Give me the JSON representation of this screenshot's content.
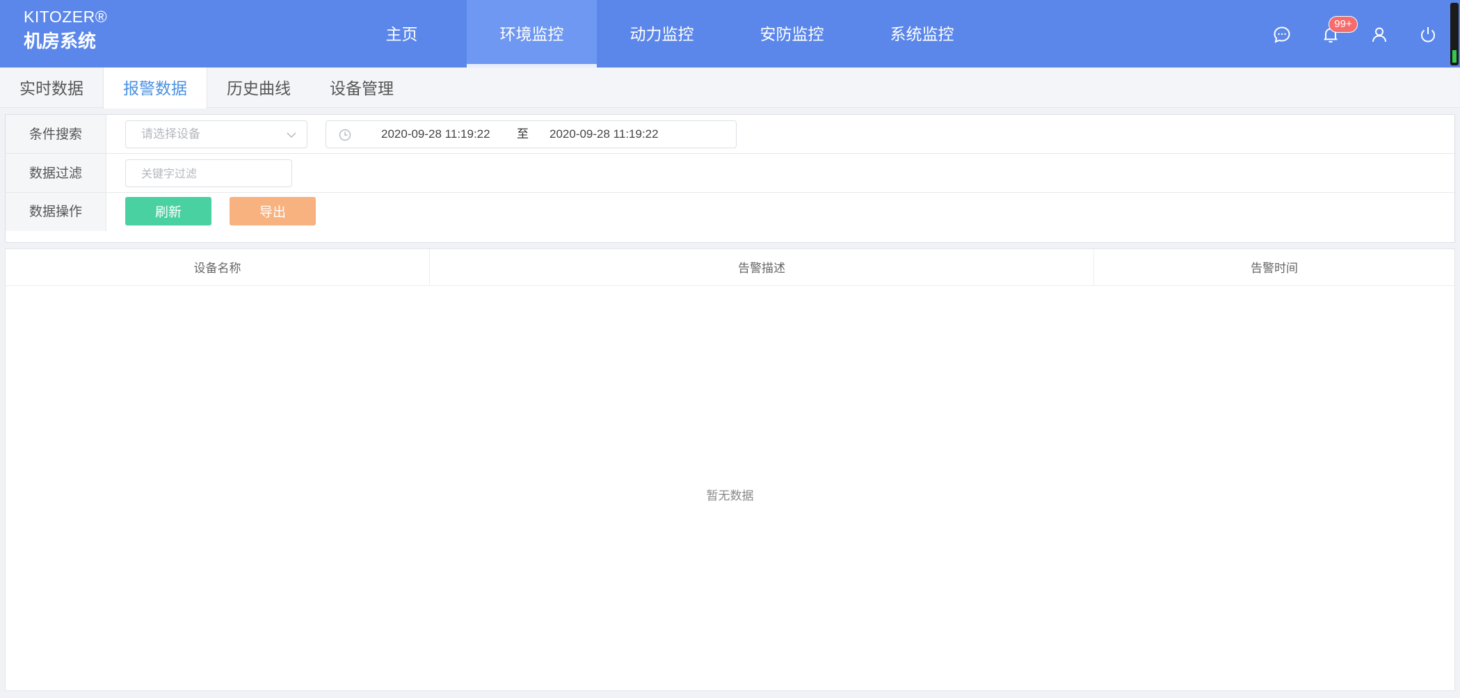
{
  "brand": {
    "name_en": "KITOZER®",
    "name_cn": "机房系统"
  },
  "nav": {
    "items": [
      {
        "label": "主页",
        "active": false
      },
      {
        "label": "环境监控",
        "active": true
      },
      {
        "label": "动力监控",
        "active": false
      },
      {
        "label": "安防监控",
        "active": false
      },
      {
        "label": "系统监控",
        "active": false
      }
    ]
  },
  "header_icons": {
    "message": "message-icon",
    "bell": "bell-icon",
    "user": "user-icon",
    "power": "power-icon",
    "notification_badge": "99+"
  },
  "subtabs": [
    {
      "label": "实时数据",
      "active": false
    },
    {
      "label": "报警数据",
      "active": true
    },
    {
      "label": "历史曲线",
      "active": false
    },
    {
      "label": "设备管理",
      "active": false
    }
  ],
  "filters": {
    "search_label": "条件搜索",
    "device_select_placeholder": "请选择设备",
    "date_start": "2020-09-28 11:19:22",
    "date_separator": "至",
    "date_end": "2020-09-28 11:19:22",
    "filter_label": "数据过滤",
    "keyword_placeholder": "关键字过滤",
    "ops_label": "数据操作",
    "refresh_label": "刷新",
    "export_label": "导出"
  },
  "table": {
    "columns": [
      "设备名称",
      "告警描述",
      "告警时间"
    ],
    "empty_text": "暂无数据"
  },
  "colors": {
    "header_bg": "#5b87ea",
    "nav_active_bg": "#6e98f1",
    "tab_active_text": "#4a90e2",
    "refresh_btn": "#4ad1a2",
    "export_btn": "#f7b27f",
    "badge": "#f56c6c"
  }
}
